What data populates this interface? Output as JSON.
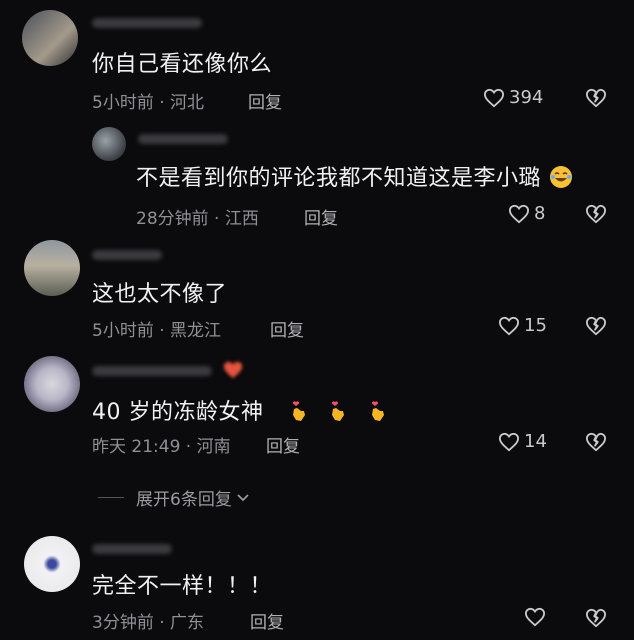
{
  "comments": [
    {
      "text": "你自己看还像你么",
      "time_location": "5小时前 · 河北",
      "reply_label": "回复",
      "likes": "394"
    },
    {
      "text": "不是看到你的评论我都不知道这是李小璐",
      "time_location": "28分钟前 · 江西",
      "reply_label": "回复",
      "likes": "8"
    },
    {
      "text": "这也太不像了",
      "time_location": "5小时前 · 黑龙江",
      "reply_label": "回复",
      "likes": "15"
    },
    {
      "text": "40 岁的冻龄女神",
      "time_location": "昨天 21:49 · 河南",
      "reply_label": "回复",
      "likes": "14"
    },
    {
      "text": "完全不一样！！！",
      "time_location": "3分钟前 · 广东",
      "reply_label": "回复",
      "likes": ""
    }
  ],
  "expand_replies": "展开6条回复",
  "colors": {
    "background": "#0b0b0d",
    "text": "#f1f1f3",
    "meta": "#8f8f96"
  }
}
